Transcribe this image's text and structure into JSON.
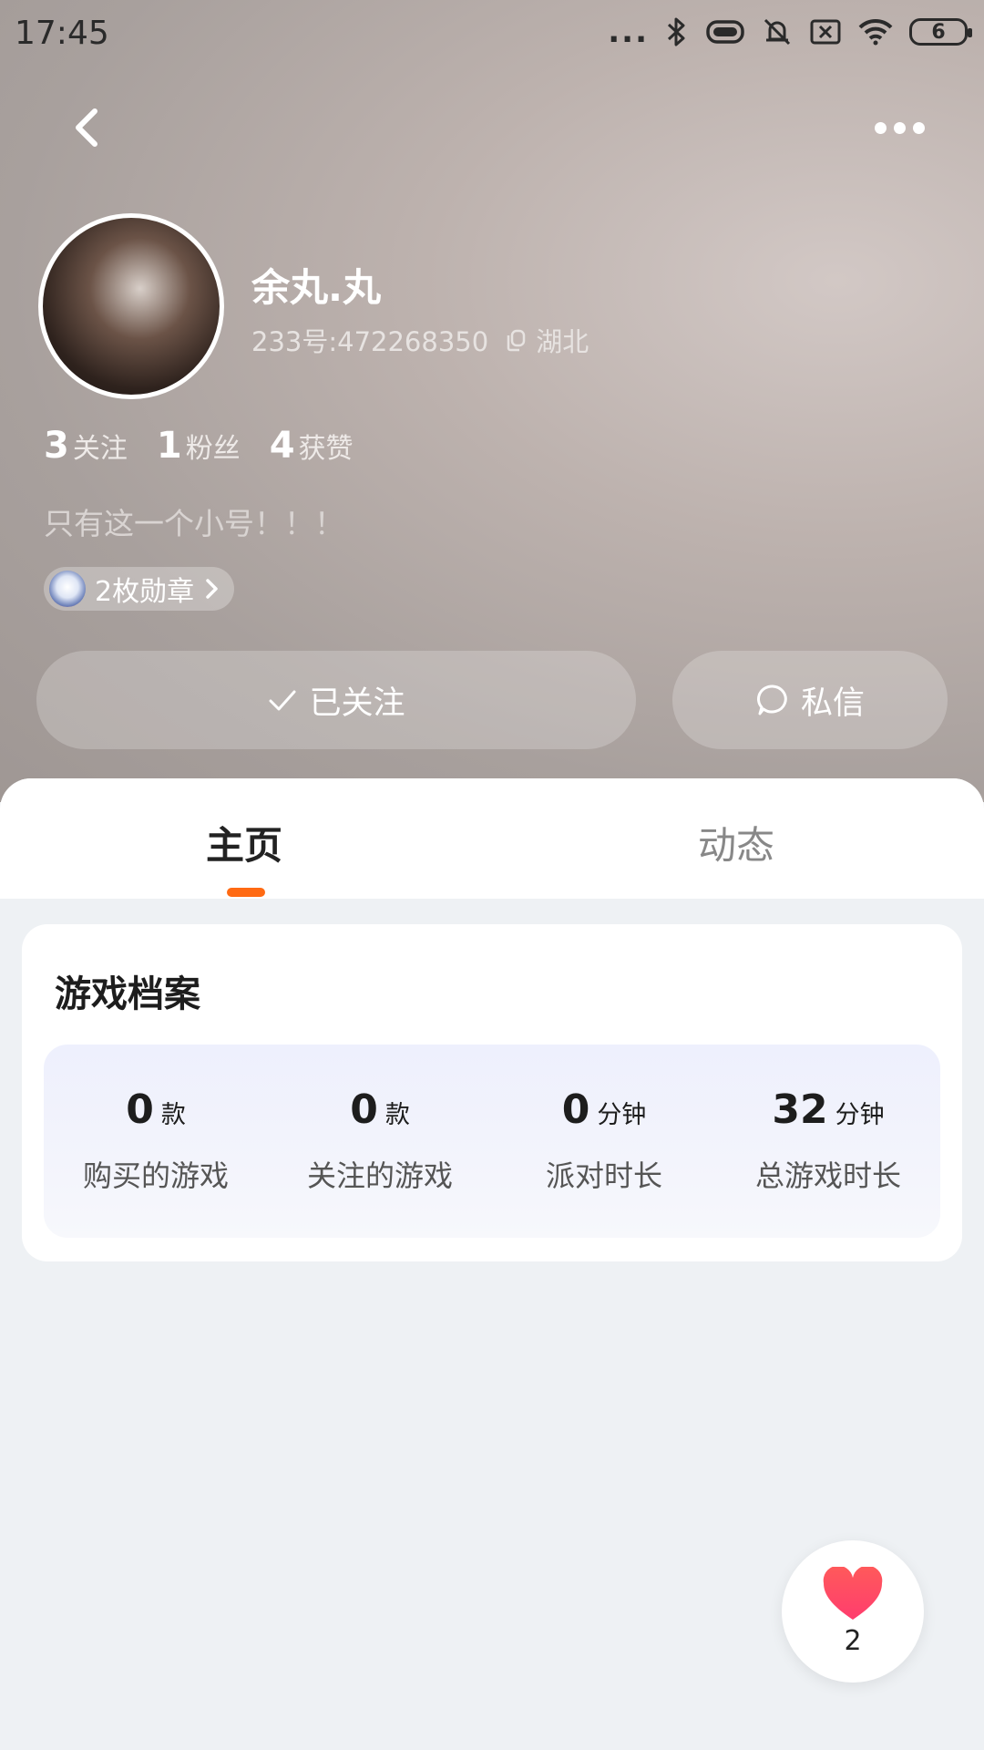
{
  "status_bar": {
    "time": "17:45",
    "dots": "...",
    "battery": "6"
  },
  "profile": {
    "username": "余丸.丸",
    "id_text": "233号:472268350",
    "location": "湖北",
    "stats": [
      {
        "num": "3",
        "label": "关注"
      },
      {
        "num": "1",
        "label": "粉丝"
      },
      {
        "num": "4",
        "label": "获赞"
      }
    ],
    "bio": "只有这一个小号！！！",
    "medals": "2枚勋章"
  },
  "actions": {
    "follow_label": "已关注",
    "message_label": "私信"
  },
  "tabs": [
    {
      "label": "主页"
    },
    {
      "label": "动态"
    }
  ],
  "game_card": {
    "title": "游戏档案",
    "stats": [
      {
        "num": "0",
        "unit": "款",
        "label": "购买的游戏"
      },
      {
        "num": "0",
        "unit": "款",
        "label": "关注的游戏"
      },
      {
        "num": "0",
        "unit": "分钟",
        "label": "派对时长"
      },
      {
        "num": "32",
        "unit": "分钟",
        "label": "总游戏时长"
      }
    ]
  },
  "like_fab": {
    "count": "2"
  },
  "colors": {
    "accent": "#ff6a13",
    "heart": "#ff4d5e"
  }
}
